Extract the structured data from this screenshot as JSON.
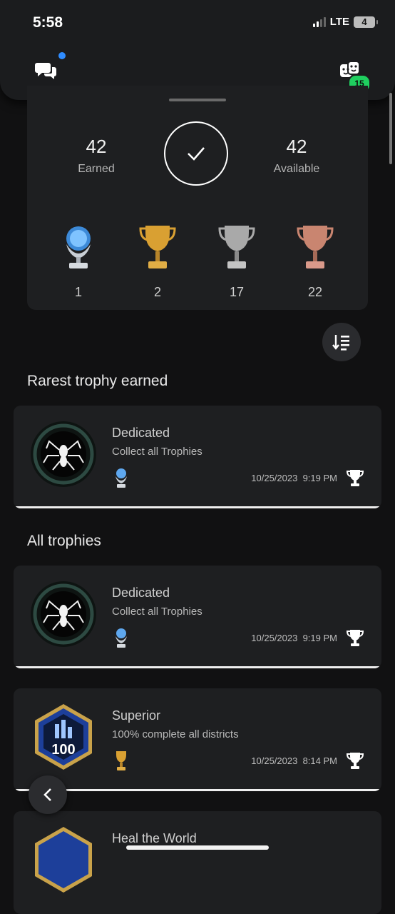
{
  "status_bar": {
    "time": "5:58",
    "network": "LTE",
    "battery": "4"
  },
  "header": {
    "friends_badge": "15"
  },
  "summary": {
    "earned_count": "42",
    "earned_label": "Earned",
    "available_count": "42",
    "available_label": "Available",
    "platinum_count": "1",
    "gold_count": "2",
    "silver_count": "17",
    "bronze_count": "22"
  },
  "sections": {
    "rarest_title": "Rarest trophy earned",
    "all_title": "All trophies"
  },
  "rarest": {
    "name": "Dedicated",
    "description": "Collect all Trophies",
    "type": "platinum",
    "date": "10/25/2023",
    "time": "9:19 PM"
  },
  "trophies": [
    {
      "name": "Dedicated",
      "description": "Collect all Trophies",
      "type": "platinum",
      "date": "10/25/2023",
      "time": "9:19 PM"
    },
    {
      "name": "Superior",
      "description": "100% complete all districts",
      "type": "gold",
      "date": "10/25/2023",
      "time": "8:14 PM",
      "badge_text": "100"
    },
    {
      "name": "Heal the World"
    }
  ],
  "colors": {
    "background": "#111112",
    "card": "#1e1f21",
    "platinum": "#6fb8ff",
    "gold": "#d9a032",
    "silver": "#bfbfbf",
    "bronze": "#c98570",
    "badge_green": "#1fcf5f"
  }
}
